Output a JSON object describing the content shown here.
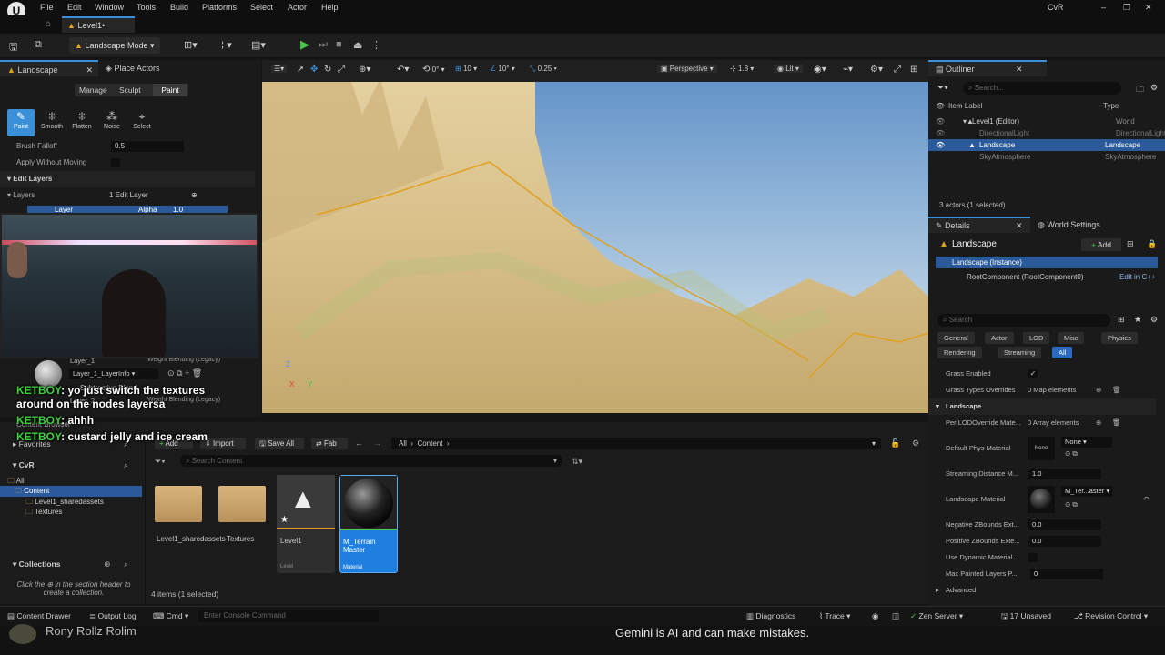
{
  "menubar": {
    "items": [
      "File",
      "Edit",
      "Window",
      "Tools",
      "Build",
      "Platforms",
      "Select",
      "Actor",
      "Help"
    ],
    "project": "CvR"
  },
  "tabs": {
    "level_tab": "Level1•"
  },
  "toolbar": {
    "mode": "Landscape Mode"
  },
  "left_panel": {
    "tab_landscape": "Landscape",
    "tab_place_actors": "Place Actors",
    "subtabs": [
      "Manage",
      "Sculpt",
      "Paint"
    ],
    "tools": [
      "Paint",
      "Smooth",
      "Flatten",
      "Noise",
      "Select"
    ],
    "brush_falloff_label": "Brush Falloff",
    "brush_falloff_value": "0.5",
    "apply_without_moving": "Apply Without Moving",
    "edit_layers": "Edit Layers",
    "layers_label": "Layers",
    "layers_value": "1 Edit Layer",
    "layer_row": {
      "name": "Layer",
      "blend": "Alpha",
      "alpha_value": "1.0"
    },
    "layer1": {
      "name": "Layer_1",
      "blend": "Weight Blending (Legacy)",
      "info": "Layer_1_LayerInfo"
    },
    "subtractive_blend": "Subtractive Blend",
    "layer2": {
      "name": "Layer_2",
      "blend": "Weight Blending (Legacy)"
    }
  },
  "viewport": {
    "perspective": "Perspective",
    "lit": "Lit",
    "fov": "1.8",
    "snap_move": "10",
    "snap_rot": "10°",
    "snap_scale": "0.25",
    "rotate_val": "0°"
  },
  "outliner": {
    "title": "Outliner",
    "search_placeholder": "Search...",
    "col_label": "Item Label",
    "col_type": "Type",
    "rows": [
      {
        "label": "Level1 (Editor)",
        "type": "World"
      },
      {
        "label": "DirectionalLight",
        "type": "DirectionalLight"
      },
      {
        "label": "Landscape",
        "type": "Landscape"
      },
      {
        "label": "SkyAtmosphere",
        "type": "SkyAtmosphere"
      }
    ],
    "status": "3 actors (1 selected)"
  },
  "details": {
    "tab_details": "Details",
    "tab_world_settings": "World Settings",
    "name": "Landscape",
    "add_label": "Add",
    "instance": "Landscape (Instance)",
    "root_component": "RootComponent (RootComponent0)",
    "edit_cpp": "Edit in C++",
    "search_placeholder": "Search",
    "filters": [
      "General",
      "Actor",
      "LOD",
      "Misc",
      "Physics",
      "Rendering",
      "Streaming",
      "All"
    ],
    "props": [
      {
        "label": "Grass Enabled",
        "value": ""
      },
      {
        "label": "Grass Types Overrides",
        "value": "0 Map elements"
      }
    ],
    "section": "Landscape",
    "lprops": [
      {
        "label": "Per LODOverride Mate...",
        "value": "0 Array elements"
      },
      {
        "label": "Default Phys Material",
        "value": "None"
      },
      {
        "label": "Streaming Distance M...",
        "value": "1.0"
      },
      {
        "label": "Landscape Material",
        "value": "M_Ter...aster"
      },
      {
        "label": "Negative ZBounds Ext...",
        "value": "0.0"
      },
      {
        "label": "Positive ZBounds Exte...",
        "value": "0.0"
      },
      {
        "label": "Use Dynamic Material...",
        "value": ""
      },
      {
        "label": "Max Painted Layers P...",
        "value": "0"
      }
    ],
    "advanced": "Advanced",
    "none_thumb": "None"
  },
  "content": {
    "favorites": "Favorites",
    "cvr": "CvR",
    "tree": [
      "All",
      "Content",
      "Level1_sharedassets",
      "Textures"
    ],
    "collections": "Collections",
    "collections_hint": "Click the ⊕ in the section header to create a collection.",
    "add": "Add",
    "import": "Import",
    "save_all": "Save All",
    "fab": "Fab",
    "path": [
      "All",
      "Content"
    ],
    "search_placeholder": "Search Content",
    "assets": [
      {
        "name": "Level1_sharedassets",
        "kind": "folder",
        "sub": ""
      },
      {
        "name": "Textures",
        "kind": "folder",
        "sub": ""
      },
      {
        "name": "Level1",
        "kind": "level",
        "sub": "Level"
      },
      {
        "name": "M_Terrain Master",
        "kind": "material",
        "sub": "Material"
      }
    ],
    "items_count": "4 items (1 selected)",
    "browser_label": "Content Browser"
  },
  "statusbar": {
    "content_drawer": "Content Drawer",
    "output_log": "Output Log",
    "cmd": "Cmd",
    "console_placeholder": "Enter Console Command",
    "diagnostics": "Diagnostics",
    "trace": "Trace",
    "zen": "Zen Server",
    "unsaved": "17 Unsaved",
    "revision": "Revision Control"
  },
  "chat": [
    {
      "name": "KETBOY",
      "msg": ": yo just switch the textures"
    },
    {
      "name": "",
      "msg": "around on the nodes layersa"
    },
    {
      "name": "KETBOY",
      "msg": ": ahhh"
    },
    {
      "name": "KETBOY",
      "msg": ": custard jelly and ice cream"
    }
  ],
  "overlay": {
    "gemini": "Gemini is AI and can make mistakes.",
    "viewers": "Rony  Rollz  Rolim"
  },
  "colors": {
    "accent": "#3a8fd9",
    "selected": "#2a5a9a",
    "play": "#47c447",
    "landscape_border": "#e0a020"
  }
}
